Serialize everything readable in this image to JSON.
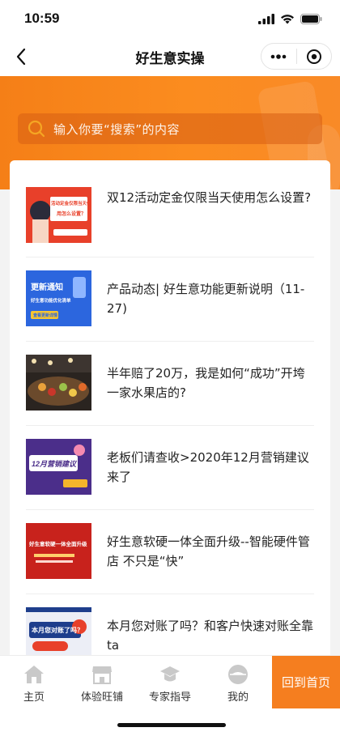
{
  "status_bar": {
    "time": "10:59",
    "icons": [
      "signal-icon",
      "wifi-icon",
      "battery-icon"
    ]
  },
  "nav": {
    "title": "好生意实操",
    "icons": [
      "back-arrow-icon",
      "more-dots-icon",
      "target-icon"
    ]
  },
  "search": {
    "placeholder": "输入你要“搜索”的内容"
  },
  "articles": [
    {
      "title": "双12活动定金仅限当天使用怎么设置?",
      "thumb_text": [
        "活动定金仅限当天使",
        "用怎么设置？"
      ]
    },
    {
      "title": "产品动态| 好生意功能更新说明（11-27)",
      "thumb_text": [
        "更新通知",
        "好生意功能优化清单",
        "查看更新详情"
      ]
    },
    {
      "title": "半年赔了20万，我是如何“成功”开垮一家水果店的?",
      "thumb_text": []
    },
    {
      "title": "老板们请查收>2020年12月营销建议来了",
      "thumb_text": [
        "12月营销建议"
      ]
    },
    {
      "title": "好生意软硬一体全面升级--智能硬件管店 不只是“快”",
      "thumb_text": [
        "好生意软硬一体全面升级"
      ]
    },
    {
      "title": "本月您对账了吗？和客户快速对账全靠ta",
      "thumb_text": [
        "本月您对账了吗？"
      ]
    }
  ],
  "tabbar": {
    "tabs": [
      {
        "label": "主页",
        "icon": "home-icon"
      },
      {
        "label": "体验旺铺",
        "icon": "shop-icon"
      },
      {
        "label": "专家指导",
        "icon": "graduation-cap-icon"
      },
      {
        "label": "我的",
        "icon": "profile-icon"
      }
    ],
    "home_button": "回到首页"
  },
  "colors": {
    "accent": "#f57e1f",
    "banner": "#fb8c1f"
  }
}
